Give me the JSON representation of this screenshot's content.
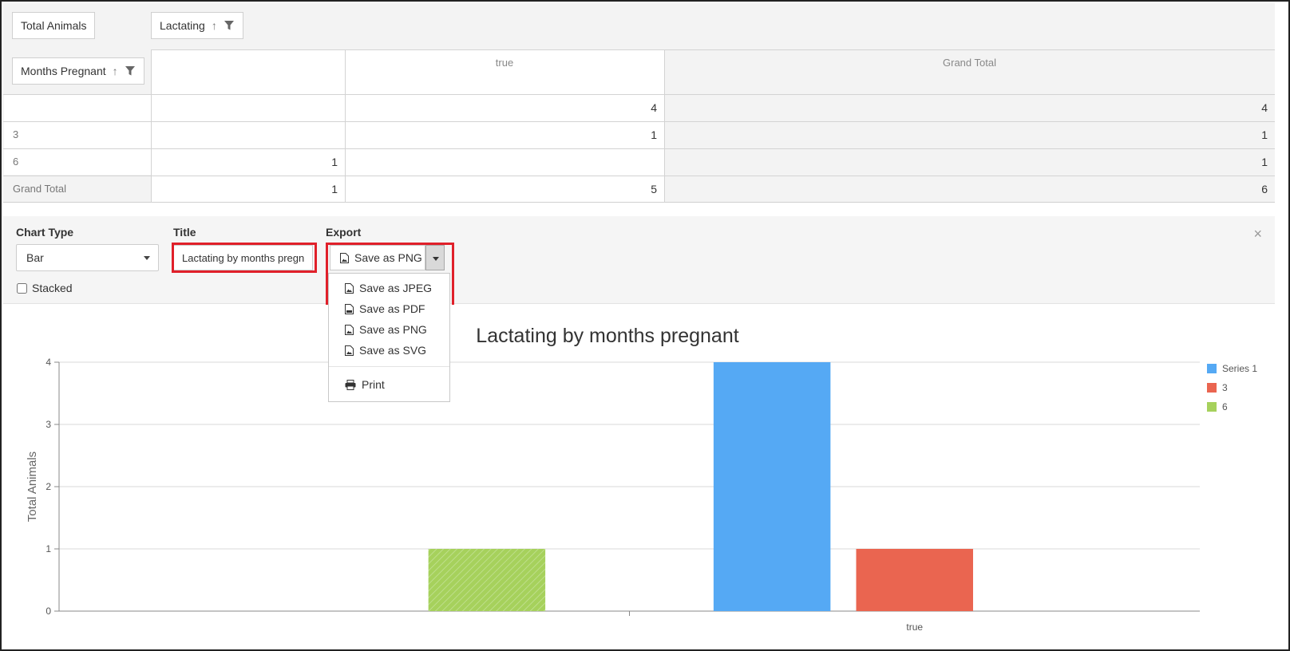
{
  "pivot": {
    "value_field": "Total Animals",
    "column_field": "Lactating",
    "row_field": "Months Pregnant",
    "col_headers": [
      "",
      "true",
      "Grand Total"
    ],
    "rows": [
      {
        "label": "",
        "values": [
          "",
          "4",
          "4"
        ]
      },
      {
        "label": "3",
        "values": [
          "",
          "1",
          "1"
        ]
      },
      {
        "label": "6",
        "values": [
          "1",
          "",
          "1"
        ]
      },
      {
        "label": "Grand Total",
        "values": [
          "1",
          "5",
          "6"
        ]
      }
    ]
  },
  "config": {
    "chart_type_label": "Chart Type",
    "chart_type_value": "Bar",
    "title_label": "Title",
    "title_value": "Lactating by months pregnant",
    "export_label": "Export",
    "export_button": "Save as PNG",
    "stacked_label": "Stacked",
    "close": "×"
  },
  "export_menu": {
    "items": [
      "Save as JPEG",
      "Save as PDF",
      "Save as PNG",
      "Save as SVG"
    ],
    "print": "Print"
  },
  "colors": {
    "series_1": "#55a9f4",
    "series_3": "#ea6550",
    "series_6": "#a6d15c",
    "highlight": "#e0202a"
  },
  "chart_data": {
    "type": "bar",
    "title": "Lactating by months pregnant",
    "ylabel": "Total Animals",
    "xlabel": "",
    "categories": [
      "",
      "true"
    ],
    "series": [
      {
        "name": "Series 1",
        "values": [
          0,
          4
        ]
      },
      {
        "name": "3",
        "values": [
          0,
          1
        ]
      },
      {
        "name": "6",
        "values": [
          1,
          0
        ]
      }
    ],
    "ylim": [
      0,
      4
    ],
    "yticks": [
      0,
      1,
      2,
      3,
      4
    ],
    "grid": true,
    "legend": "right"
  }
}
